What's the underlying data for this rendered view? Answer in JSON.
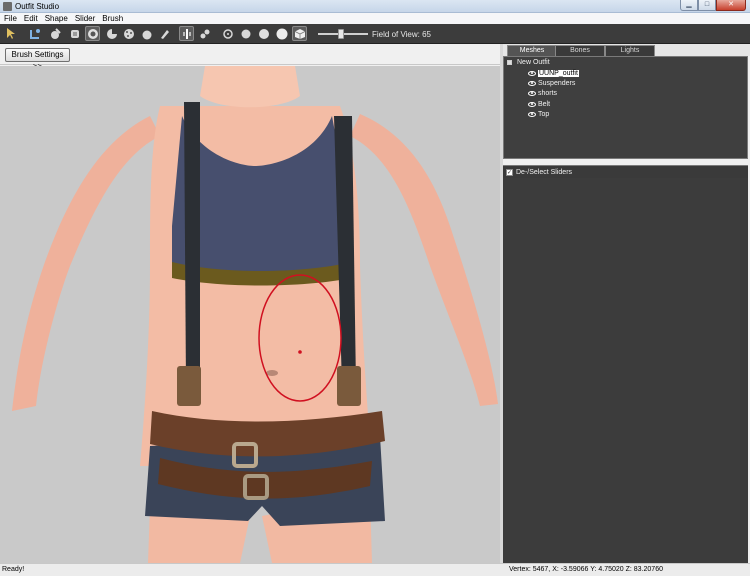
{
  "window": {
    "title": "Outfit Studio"
  },
  "menu": {
    "items": [
      "File",
      "Edit",
      "Shape",
      "Slider",
      "Brush"
    ]
  },
  "toolbar": {
    "fov_label": "Field of View: 65",
    "fov_slider_value": 0.42,
    "tools": [
      {
        "name": "select-tool",
        "icon": "cursor-icon"
      },
      {
        "name": "transform-tool",
        "icon": "transform-icon"
      },
      {
        "name": "mask-brush",
        "icon": "mask-brush-icon"
      },
      {
        "name": "inflate-brush",
        "icon": "inflate-brush-icon"
      },
      {
        "name": "deflate-brush",
        "icon": "deflate-brush-icon"
      },
      {
        "name": "move-brush",
        "icon": "move-brush-icon"
      },
      {
        "name": "smooth-brush",
        "icon": "smooth-brush-icon"
      },
      {
        "name": "weight-brush",
        "icon": "weight-brush-icon"
      },
      {
        "name": "color-brush",
        "icon": "color-brush-icon"
      },
      {
        "name": "alpha-brush",
        "icon": "alpha-brush-icon"
      }
    ]
  },
  "brush_settings": {
    "label": "Brush Settings >>"
  },
  "right_panel": {
    "tabs": [
      "Meshes",
      "Bones",
      "Lights"
    ],
    "active_tab": "Meshes",
    "tree": {
      "root": "New Outfit",
      "items": [
        "UUNP_outfit",
        "Suspenders",
        "shorts",
        "Belt",
        "Top"
      ],
      "selected": "UUNP_outfit"
    },
    "sliders_header": "De-/Select Sliders"
  },
  "status": {
    "left": "Ready!",
    "right": "Vertex: 5467, X: -3.59066 Y: 4.75020 Z: 83.20760"
  },
  "colors": {
    "toolbar_bg": "#3c3c3c",
    "panel_bg": "#3f3f3f",
    "viewport_bg": "#c9c9c9",
    "skin": "#f2b9a2",
    "top_fabric": "#474f6e",
    "belt_leather": "#6b4029",
    "denim": "#3a4458",
    "brush_circle": "#d01020"
  }
}
